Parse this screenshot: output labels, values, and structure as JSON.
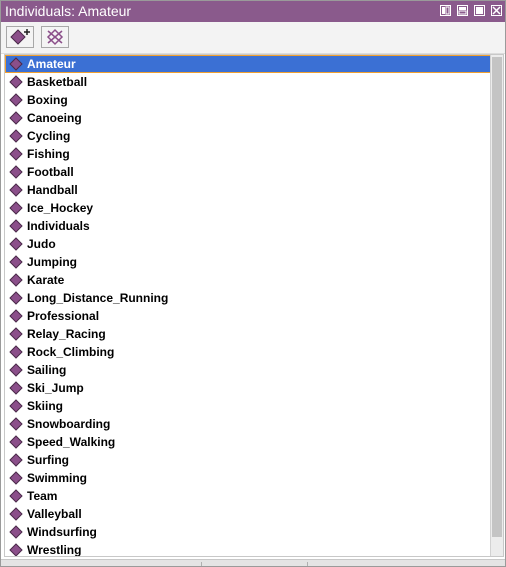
{
  "window": {
    "title": "Individuals: Amateur"
  },
  "toolbar": {
    "add_icon": "add-individual-icon",
    "delete_icon": "delete-individual-icon"
  },
  "colors": {
    "titlebar": "#8a5a8c",
    "selection": "#3b70d4",
    "diamond": "#8b4f8a"
  },
  "individuals": {
    "selected": "Amateur",
    "items": [
      "Amateur",
      "Basketball",
      "Boxing",
      "Canoeing",
      "Cycling",
      "Fishing",
      "Football",
      "Handball",
      "Ice_Hockey",
      "Individuals",
      "Judo",
      "Jumping",
      "Karate",
      "Long_Distance_Running",
      "Professional",
      "Relay_Racing",
      "Rock_Climbing",
      "Sailing",
      "Ski_Jump",
      "Skiing",
      "Snowboarding",
      "Speed_Walking",
      "Surfing",
      "Swimming",
      "Team",
      "Valleyball",
      "Windsurfing",
      "Wrestling"
    ]
  }
}
